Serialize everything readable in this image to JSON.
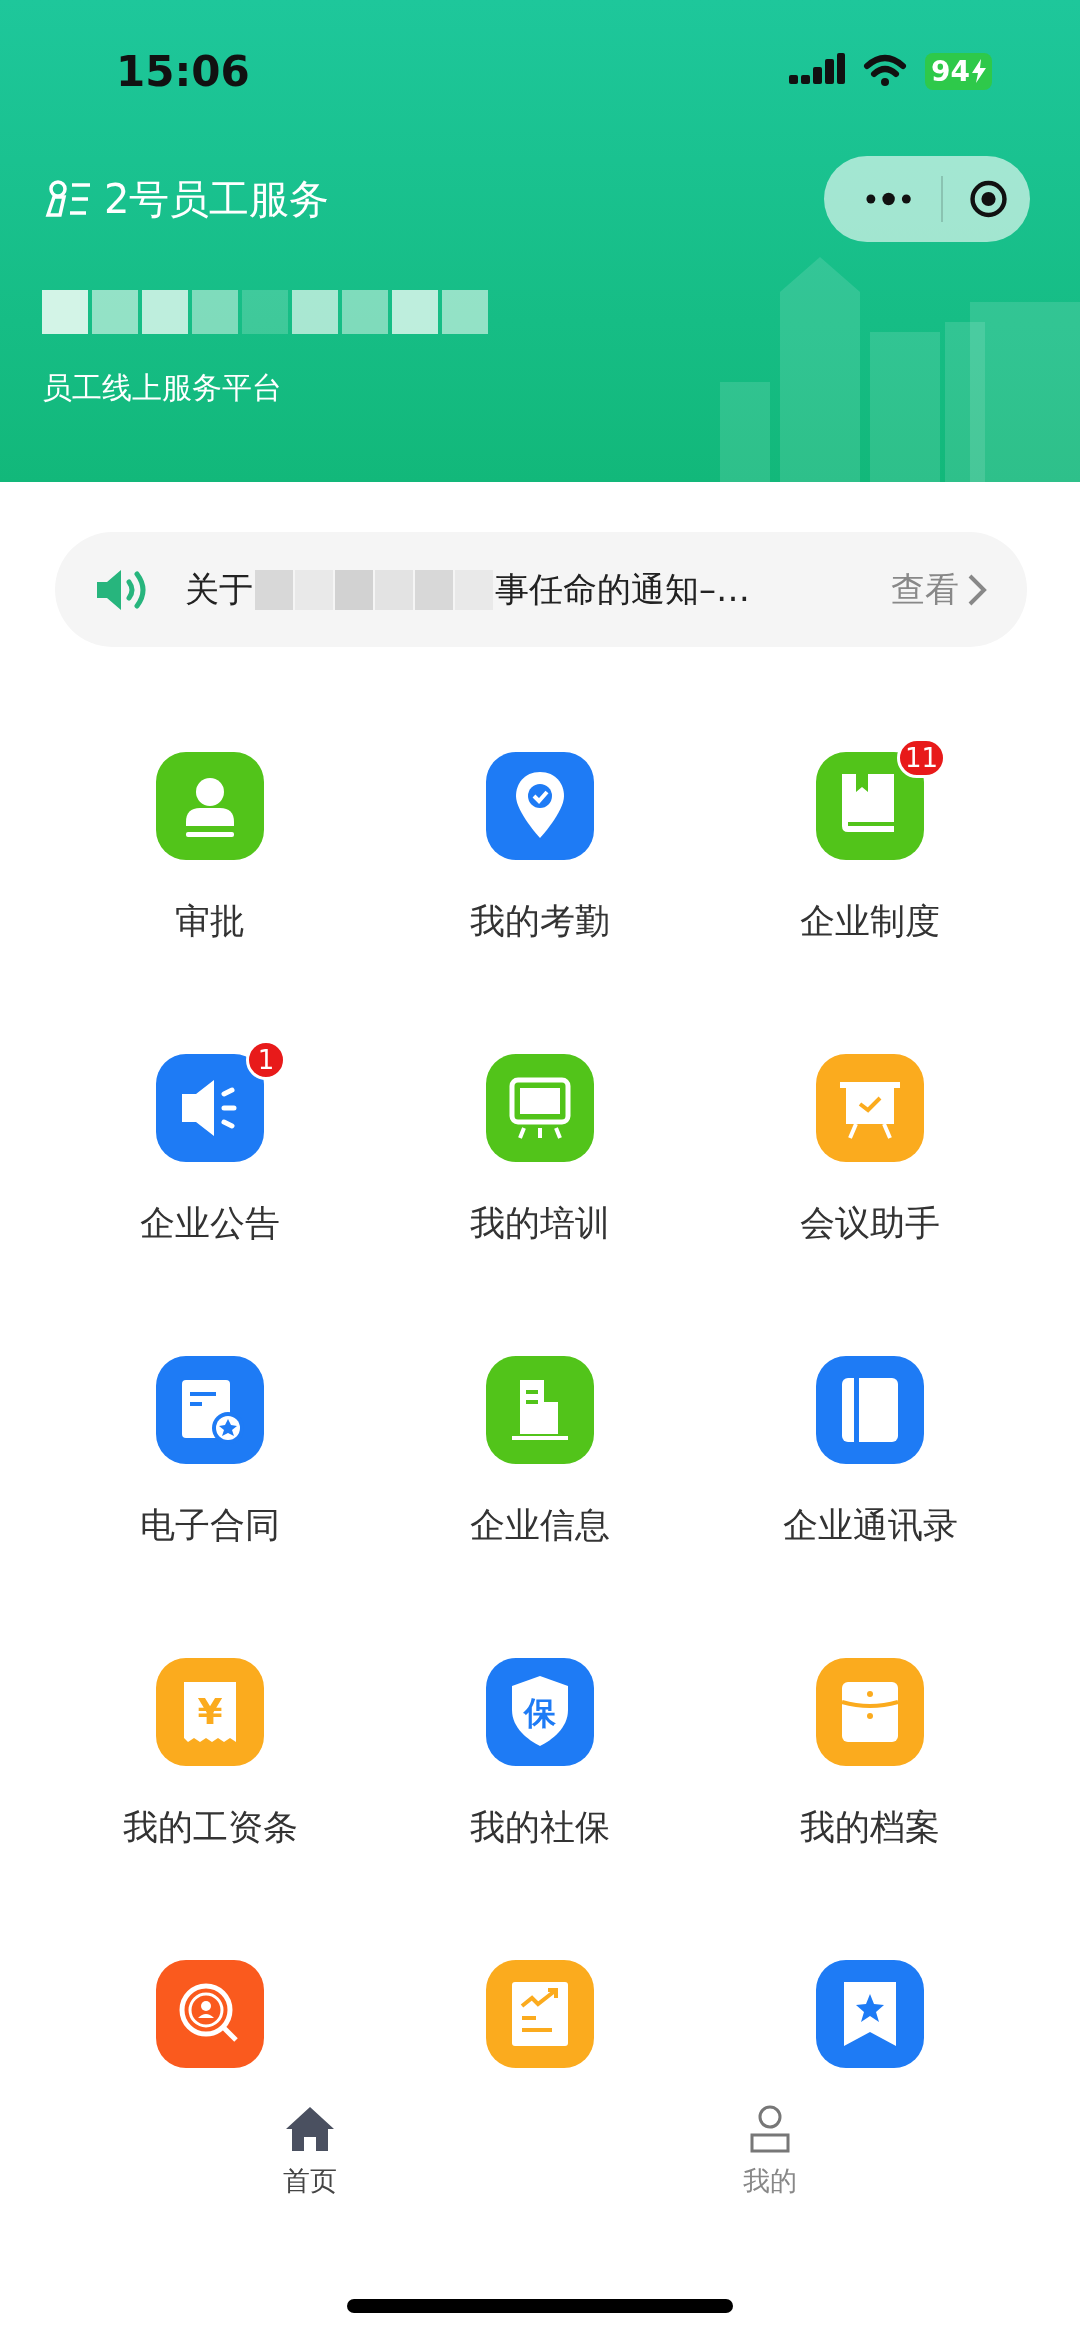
{
  "status_bar": {
    "time": "15:06",
    "battery": "94",
    "charging": true
  },
  "header": {
    "app_title": "2号员工服务",
    "company_redacted": true,
    "subtitle": "员工线上服务平台"
  },
  "notice": {
    "text_start": "关于",
    "redacted": true,
    "text_end": "事任命的通知–…",
    "action": "查看"
  },
  "grid": [
    {
      "label": "审批",
      "kind": "stamp",
      "color": "#52c41a"
    },
    {
      "label": "我的考勤",
      "kind": "pin",
      "color": "#1e7bf5"
    },
    {
      "label": "企业制度",
      "kind": "book",
      "color": "#52c41a",
      "badge": "11"
    },
    {
      "label": "企业公告",
      "kind": "megaphone",
      "color": "#1e7bf5",
      "badge": "1"
    },
    {
      "label": "我的培训",
      "kind": "screen",
      "color": "#52c41a"
    },
    {
      "label": "会议助手",
      "kind": "easel",
      "color": "#fbab1e"
    },
    {
      "label": "电子合同",
      "kind": "contract",
      "color": "#1e7bf5"
    },
    {
      "label": "企业信息",
      "kind": "building",
      "color": "#52c41a"
    },
    {
      "label": "企业通讯录",
      "kind": "notebook",
      "color": "#1e7bf5"
    },
    {
      "label": "我的工资条",
      "kind": "receipt",
      "color": "#fbab1e",
      "glyph": "¥"
    },
    {
      "label": "我的社保",
      "kind": "shield",
      "color": "#1e7bf5",
      "glyph": "保"
    },
    {
      "label": "我的档案",
      "kind": "folder",
      "color": "#fbab1e"
    },
    {
      "kind": "search",
      "color": "#fa5a1e"
    },
    {
      "kind": "report",
      "color": "#fbab1e"
    },
    {
      "kind": "bookmark",
      "color": "#1e7bf5"
    }
  ],
  "tab_bar": [
    {
      "label": "首页",
      "kind": "home",
      "selected": true
    },
    {
      "label": "我的",
      "kind": "person",
      "selected": false
    }
  ]
}
